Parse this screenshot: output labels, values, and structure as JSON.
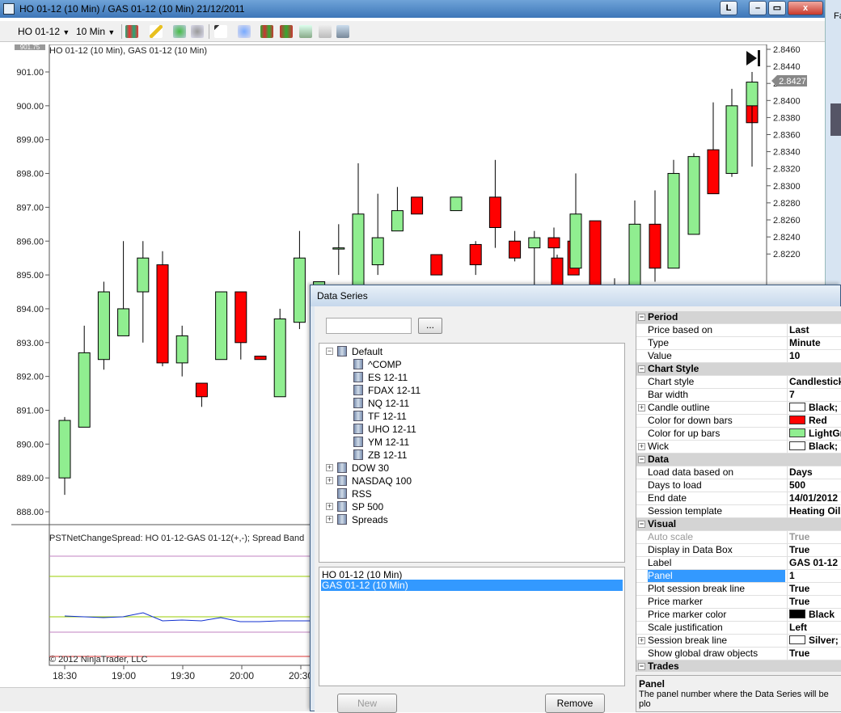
{
  "window": {
    "title": "HO 01-12 (10 Min) / GAS 01-12 (10 Min)  21/12/2011",
    "btn_l": "L",
    "btn_min": "–",
    "btn_max": "▭",
    "btn_close": "x",
    "side_text": "Fa"
  },
  "toolbar": {
    "instrument": "HO 01-12",
    "interval": "10 Min"
  },
  "chart": {
    "label": "HO 01-12 (10 Min), GAS 01-12 (10 Min)",
    "indicator_label": "PSTNetChangeSpread: HO 01-12-GAS 01-12(+,-); Spread Band ",
    "copyright": "© 2012 NinjaTrader, LLC",
    "top_clipped_label": "901.75",
    "price_marker": "2.8427",
    "colors": {
      "up": "#90ee90",
      "down": "#ff0000"
    }
  },
  "chart_data": {
    "type": "candlestick",
    "x_ticks": [
      "18:30",
      "19:00",
      "19:30",
      "20:00",
      "20:30"
    ],
    "left_axis_ticks": [
      "901.00",
      "900.00",
      "899.00",
      "898.00",
      "897.00",
      "896.00",
      "895.00",
      "894.00",
      "893.00",
      "892.00",
      "891.00",
      "890.00",
      "889.00",
      "888.00"
    ],
    "right_axis_ticks": [
      "2.8460",
      "2.8440",
      "2.8420",
      "2.8400",
      "2.8380",
      "2.8360",
      "2.8340",
      "2.8320",
      "2.8300",
      "2.8280",
      "2.8260",
      "2.8240",
      "2.8220"
    ],
    "candles": [
      {
        "o": 889.0,
        "h": 890.8,
        "l": 888.5,
        "c": 890.7
      },
      {
        "o": 890.5,
        "h": 893.5,
        "l": 890.5,
        "c": 892.7
      },
      {
        "o": 892.5,
        "h": 894.8,
        "l": 892.2,
        "c": 894.5
      },
      {
        "o": 893.2,
        "h": 896.0,
        "l": 893.2,
        "c": 894.0
      },
      {
        "o": 894.5,
        "h": 896.0,
        "l": 893.0,
        "c": 895.5
      },
      {
        "o": 895.3,
        "h": 895.7,
        "l": 892.3,
        "c": 892.4
      },
      {
        "o": 892.4,
        "h": 893.5,
        "l": 892.0,
        "c": 893.2
      },
      {
        "o": 891.8,
        "h": 891.8,
        "l": 891.1,
        "c": 891.4
      },
      {
        "o": 892.5,
        "h": 894.5,
        "l": 892.5,
        "c": 894.5
      },
      {
        "o": 894.5,
        "h": 894.5,
        "l": 892.5,
        "c": 893.0
      },
      {
        "o": 892.6,
        "h": 892.6,
        "l": 892.5,
        "c": 892.5
      },
      {
        "o": 891.4,
        "h": 894.0,
        "l": 891.4,
        "c": 893.7
      },
      {
        "o": 893.6,
        "h": 896.3,
        "l": 893.4,
        "c": 895.5
      },
      {
        "o": 894.6,
        "h": 894.8,
        "l": 893.8,
        "c": 894.8
      },
      {
        "o": 895.8,
        "h": 896.5,
        "l": 895.0,
        "c": 895.8
      },
      {
        "o": 894.7,
        "h": 898.3,
        "l": 894.7,
        "c": 896.8
      },
      {
        "o": 895.3,
        "h": 897.4,
        "l": 895.0,
        "c": 896.1
      },
      {
        "o": 896.3,
        "h": 897.6,
        "l": 896.3,
        "c": 896.9
      },
      {
        "o": 897.3,
        "h": 897.3,
        "l": 896.8,
        "c": 896.8
      },
      {
        "o": 895.6,
        "h": 895.6,
        "l": 895.0,
        "c": 895.0
      },
      {
        "o": 896.9,
        "h": 897.3,
        "l": 896.9,
        "c": 897.3
      },
      {
        "o": 895.9,
        "h": 896.0,
        "l": 895.0,
        "c": 895.3
      },
      {
        "o": 897.3,
        "h": 898.4,
        "l": 895.8,
        "c": 896.4
      },
      {
        "o": 896.0,
        "h": 896.3,
        "l": 895.4,
        "c": 895.5
      },
      {
        "o": 895.8,
        "h": 896.3,
        "l": 894.6,
        "c": 896.1
      },
      {
        "o": 896.1,
        "h": 896.4,
        "l": 895.5,
        "c": 895.8
      },
      {
        "o": 896.0,
        "h": 896.0,
        "l": 895.0,
        "c": 895.0
      }
    ],
    "overlay_candles": [
      {
        "x": 675,
        "o": 895.5,
        "c": 894.5,
        "h": 895.6,
        "l": 894.4
      },
      {
        "x": 698,
        "o": 895.2,
        "c": 896.8,
        "h": 898.0,
        "l": 895.2
      },
      {
        "x": 722,
        "o": 896.6,
        "c": 894.2,
        "h": 896.6,
        "l": 894.2
      },
      {
        "x": 746,
        "o": 894.6,
        "c": 894.4,
        "h": 894.9,
        "l": 894.2
      },
      {
        "x": 771,
        "o": 894.5,
        "c": 896.5,
        "h": 897.2,
        "l": 894.5
      },
      {
        "x": 796,
        "o": 896.5,
        "c": 895.2,
        "h": 897.5,
        "l": 894.8
      },
      {
        "x": 819,
        "o": 895.2,
        "c": 898.0,
        "h": 898.4,
        "l": 895.2
      },
      {
        "x": 844,
        "o": 896.2,
        "c": 898.5,
        "h": 898.6,
        "l": 896.2
      },
      {
        "x": 868,
        "o": 898.7,
        "c": 897.4,
        "h": 900.1,
        "l": 897.4
      },
      {
        "x": 891,
        "o": 898.0,
        "c": 900.0,
        "h": 900.5,
        "l": 897.9
      },
      {
        "x": 916,
        "o": 900.1,
        "c": 899.5,
        "h": 901.0,
        "l": 898.2
      },
      {
        "x": 916,
        "o": 900.0,
        "c": 900.7,
        "h": 901.0,
        "l": 899.5
      }
    ]
  },
  "dialog": {
    "title": "Data Series",
    "search_button": "...",
    "tree": {
      "root": "Default",
      "children": [
        "^COMP",
        "ES 12-11",
        "FDAX 12-11",
        "NQ 12-11",
        "TF 12-11",
        "UHO 12-11",
        "YM 12-11",
        "ZB 12-11"
      ],
      "others": [
        "DOW 30",
        "NASDAQ 100",
        "RSS",
        "SP 500",
        "Spreads"
      ]
    },
    "series": [
      "HO 01-12 (10 Min)",
      "GAS 01-12 (10 Min)"
    ],
    "new_button": "New",
    "remove_button": "Remove",
    "properties": [
      {
        "type": "cat",
        "name": "Period"
      },
      {
        "name": "Price based on",
        "value": "Last"
      },
      {
        "name": "Type",
        "value": "Minute"
      },
      {
        "name": "Value",
        "value": "10"
      },
      {
        "type": "cat",
        "name": "Chart Style"
      },
      {
        "name": "Chart style",
        "value": "Candlestick"
      },
      {
        "name": "Bar width",
        "value": "7"
      },
      {
        "name": "Candle outline",
        "value": "Black; 1p",
        "swatch": "#ffffff",
        "exp": true
      },
      {
        "name": "Color for down bars",
        "value": "Red",
        "swatch": "#ff0000"
      },
      {
        "name": "Color for up bars",
        "value": "LightGr",
        "swatch": "#90ee90"
      },
      {
        "name": "Wick",
        "value": "Black; 1p",
        "swatch": "#ffffff",
        "exp": true
      },
      {
        "type": "cat",
        "name": "Data"
      },
      {
        "name": "Load data based on",
        "value": "Days"
      },
      {
        "name": "Days to load",
        "value": "500"
      },
      {
        "name": "End date",
        "value": "14/01/2012"
      },
      {
        "name": "Session template",
        "value": "Heating Oil -"
      },
      {
        "type": "cat",
        "name": "Visual"
      },
      {
        "name": "Auto scale",
        "value": "True",
        "disabled": true
      },
      {
        "name": "Display in Data Box",
        "value": "True"
      },
      {
        "name": "Label",
        "value": "GAS 01-12"
      },
      {
        "name": "Panel",
        "value": "1",
        "highlight": true
      },
      {
        "name": "Plot session break line",
        "value": "True"
      },
      {
        "name": "Price marker",
        "value": "True"
      },
      {
        "name": "Price marker color",
        "value": "Black",
        "swatch": "#000000"
      },
      {
        "name": "Scale justification",
        "value": "Left"
      },
      {
        "name": "Session break line",
        "value": "Silver;",
        "swatch": "#ffffff",
        "exp": true
      },
      {
        "name": "Show global draw objects",
        "value": "True"
      },
      {
        "type": "cat",
        "name": "Trades"
      }
    ],
    "desc_title": "Panel",
    "desc_text": "The panel number where the Data Series will be plo"
  }
}
